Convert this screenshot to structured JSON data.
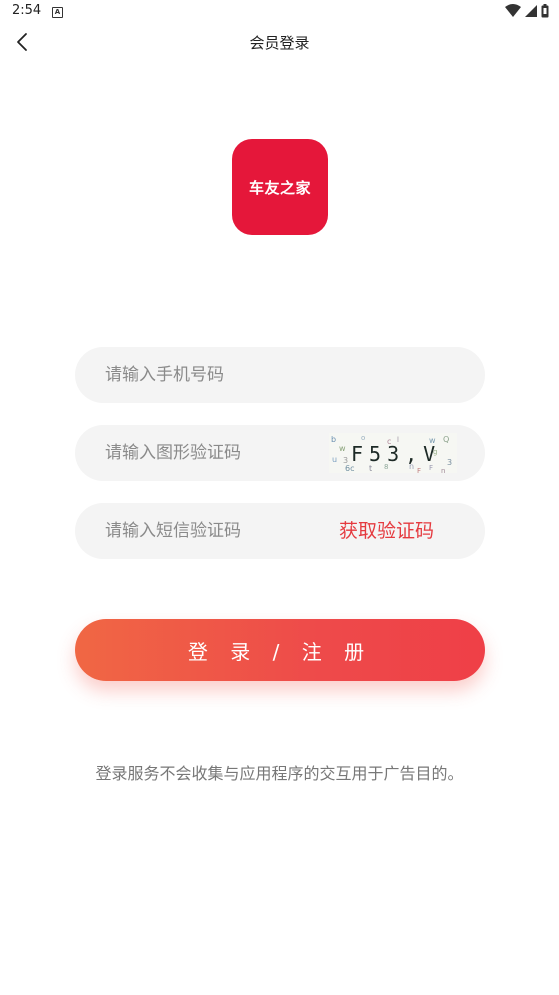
{
  "status_bar": {
    "time": "2:54",
    "notification_icon_text": "A"
  },
  "nav": {
    "title": "会员登录"
  },
  "logo": {
    "text": "车友之家",
    "color": "#e5173a"
  },
  "form": {
    "phone_placeholder": "请输入手机号码",
    "captcha_placeholder": "请输入图形验证码",
    "captcha_text": "F53,V",
    "sms_placeholder": "请输入短信验证码",
    "get_code_label": "获取验证码"
  },
  "login_button": {
    "label": "登 录 / 注 册"
  },
  "notice": "登录服务不会收集与应用程序的交互用于广告目的。",
  "colors": {
    "accent": "#e53a3f",
    "button_gradient_start": "#f06744",
    "button_gradient_end": "#ef3f47"
  }
}
